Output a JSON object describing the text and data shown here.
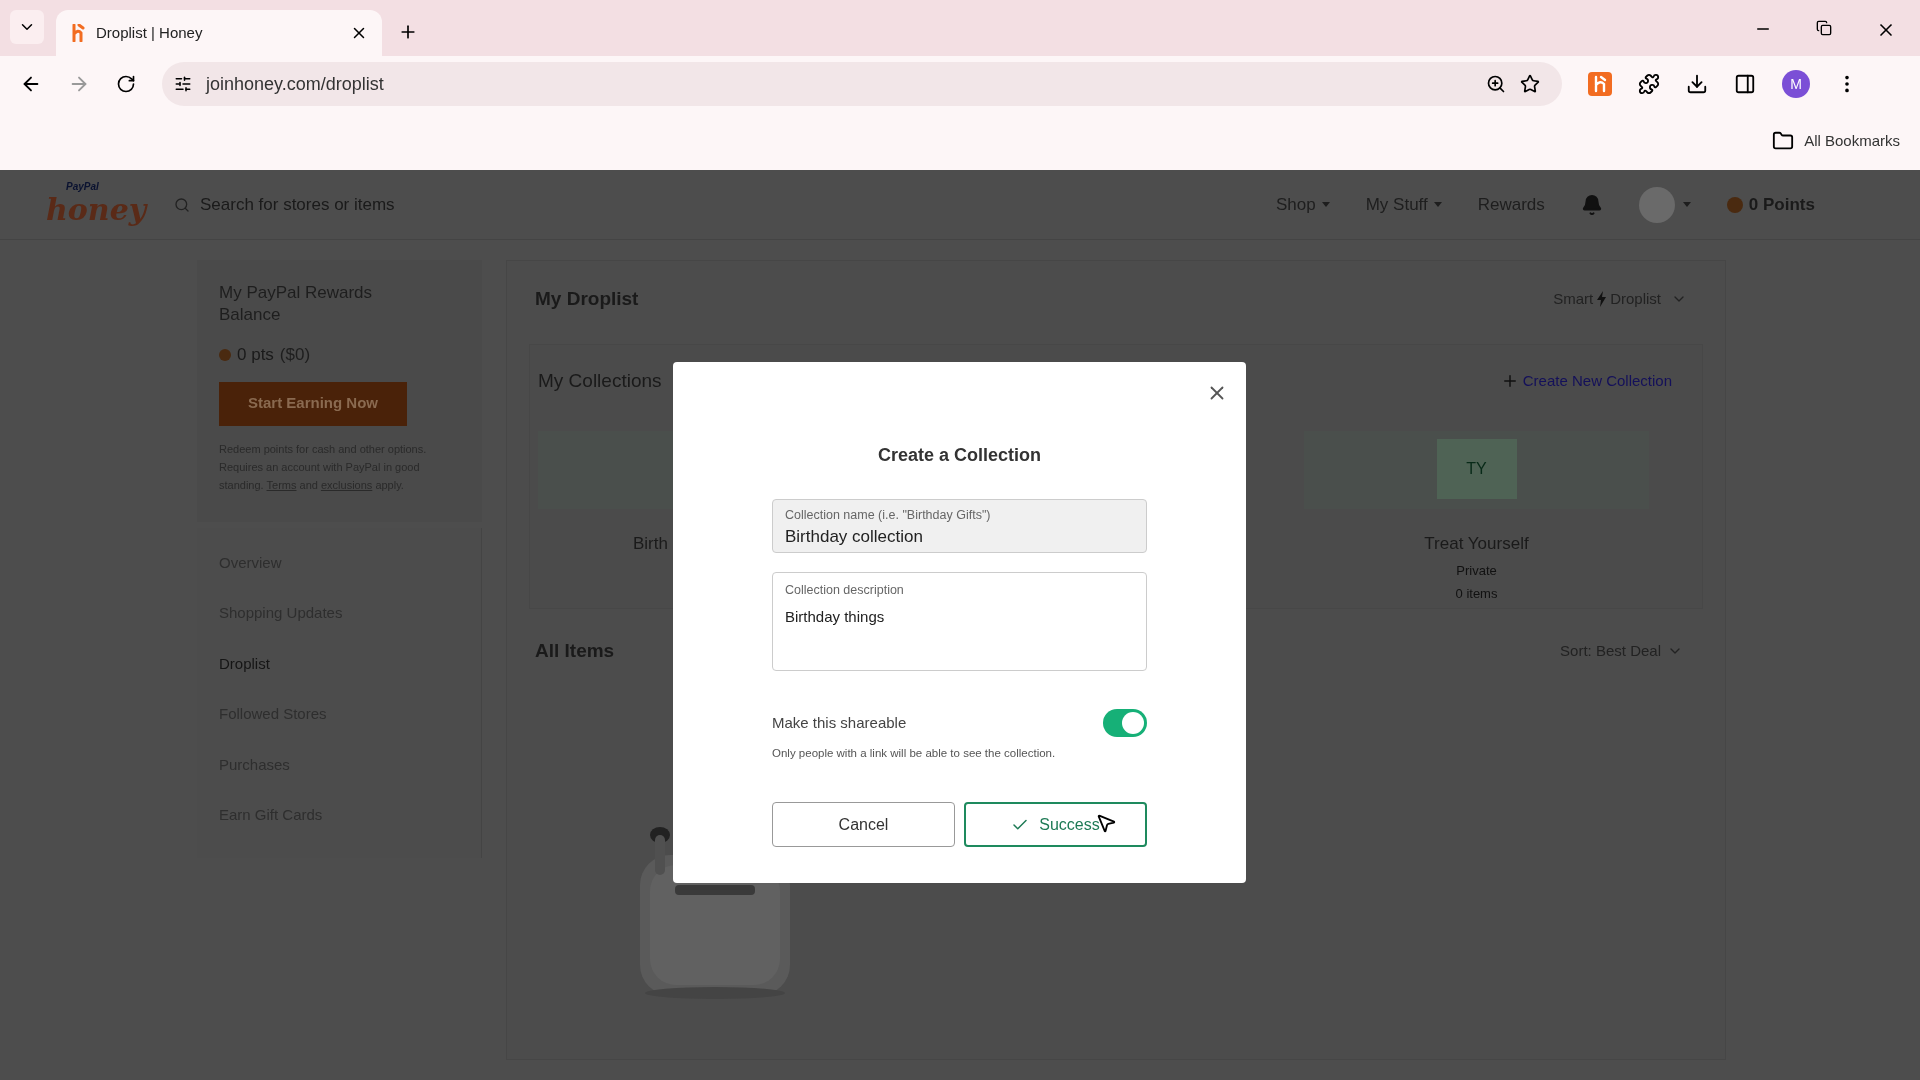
{
  "browser": {
    "tab_title": "Droplist | Honey",
    "url": "joinhoney.com/droplist",
    "bookmarks": "All Bookmarks",
    "avatar": "M"
  },
  "header": {
    "logo_small": "PayPal",
    "logo": "honey",
    "search": {
      "placeholder": "Search for stores or items"
    },
    "nav": [
      "Shop",
      "My Stuff"
    ],
    "rewards": "Rewards",
    "points": "0 Points"
  },
  "sidebar": {
    "title": "My PayPal Rewards Balance",
    "points": "0 pts",
    "dollars": "($0)",
    "button": "Start Earning Now",
    "note_before": "Redeem points for cash and other options. Requires an account with PayPal in good standing.",
    "terms_link": "Terms",
    "note_middle": "and",
    "exclusions_link": "exclusions",
    "note_after": "apply.",
    "nav": [
      {
        "label": "Overview",
        "selected": false
      },
      {
        "label": "Shopping Updates",
        "selected": false
      },
      {
        "label": "Droplist",
        "selected": true
      },
      {
        "label": "Followed Stores",
        "selected": false
      },
      {
        "label": "Purchases",
        "selected": false
      },
      {
        "label": "Earn Gift Cards",
        "selected": false
      }
    ]
  },
  "main": {
    "title": "My Droplist",
    "smart": "Smart",
    "droplist": "Droplist",
    "collections_title": "My Collections",
    "create_link": "Create New Collection",
    "collections": [
      {
        "name": "Birth"
      },
      {
        "initials": "TY",
        "name": "Treat Yourself",
        "privacy": "Private",
        "count": "0 items"
      }
    ],
    "all_items_title": "All Items",
    "sort": "Sort: Best Deal"
  },
  "modal": {
    "title": "Create a Collection",
    "name_field": {
      "label": "Collection name (i.e. \"Birthday Gifts\")",
      "value": "Birthday collection"
    },
    "description_field": {
      "label": "Collection description",
      "value": "Birthday things"
    },
    "shareable": {
      "label": "Make this shareable",
      "on": true,
      "note": "Only people with a link will be able to see the collection."
    },
    "cancel": "Cancel",
    "submit": "Success"
  }
}
